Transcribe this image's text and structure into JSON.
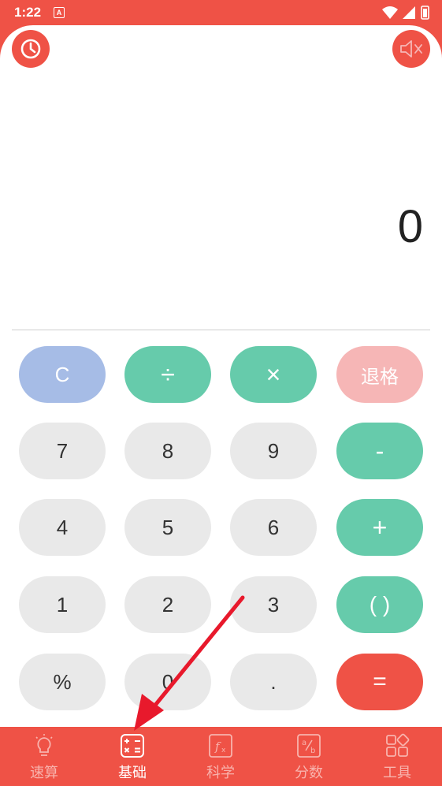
{
  "status_bar": {
    "time": "1:22",
    "notif_letter": "A"
  },
  "header": {
    "history_icon": "clock-icon",
    "mute_icon": "speaker-muted-icon"
  },
  "display": {
    "value": "0"
  },
  "keypad": {
    "rows": [
      [
        "C",
        "÷",
        "×",
        "退格"
      ],
      [
        "7",
        "8",
        "9",
        "-"
      ],
      [
        "4",
        "5",
        "6",
        "+"
      ],
      [
        "1",
        "2",
        "3",
        "( )"
      ],
      [
        "%",
        "0",
        ".",
        "="
      ]
    ]
  },
  "nav": {
    "items": [
      {
        "label": "速算",
        "icon": "lightbulb-icon",
        "active": false
      },
      {
        "label": "基础",
        "icon": "calculator-icon",
        "active": true
      },
      {
        "label": "科学",
        "icon": "function-icon",
        "active": false
      },
      {
        "label": "分数",
        "icon": "fraction-icon",
        "active": false
      },
      {
        "label": "工具",
        "icon": "grid-icon",
        "active": false
      }
    ]
  },
  "colors": {
    "accent": "#ef5246",
    "operator": "#66cbab",
    "clear": "#a6bce6",
    "backspace": "#f6b6b6",
    "digit_key": "#e9e9e9",
    "nav_inactive_text": "#f8b3ad"
  }
}
